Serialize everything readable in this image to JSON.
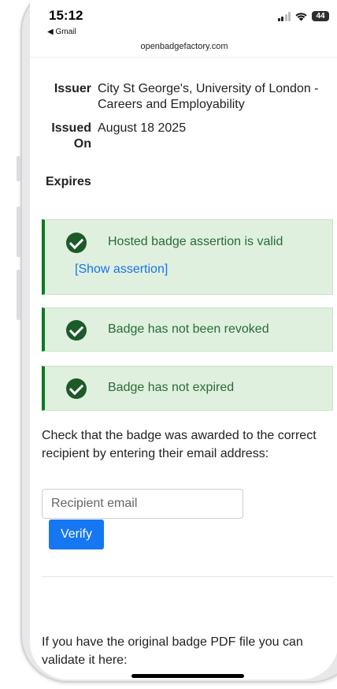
{
  "status_bar": {
    "time": "15:12",
    "back_app": "◀ Gmail",
    "battery": "44",
    "wifi_icon": "wifi-icon",
    "signal_icon": "signal-icon"
  },
  "browser": {
    "url": "openbadgefactory.com"
  },
  "details": {
    "issuer_label": "Issuer",
    "issuer_value": "City St George's, University of London - Careers and Employability",
    "issued_label": "Issued On",
    "issued_value": "August 18 2025",
    "expires_label": "Expires",
    "expires_value": "-"
  },
  "checks": [
    {
      "text": "Hosted badge assertion is valid",
      "icon": "check-circle-icon",
      "link": "[Show assertion]"
    },
    {
      "text": "Badge has not been revoked",
      "icon": "check-circle-icon"
    },
    {
      "text": "Badge has not expired",
      "icon": "check-circle-icon"
    }
  ],
  "colors": {
    "success_bg": "#dff0df",
    "success_border": "#0c7a22",
    "success_text": "#2a6b35",
    "primary": "#1677f2",
    "link": "#1a73e8"
  },
  "verify": {
    "instructions": "Check that the badge was awarded to the correct recipient by entering their email address:",
    "email_placeholder": "Recipient email",
    "button_label": "Verify"
  },
  "pdf": {
    "text": "If you have the original badge PDF file you can validate it here:"
  }
}
